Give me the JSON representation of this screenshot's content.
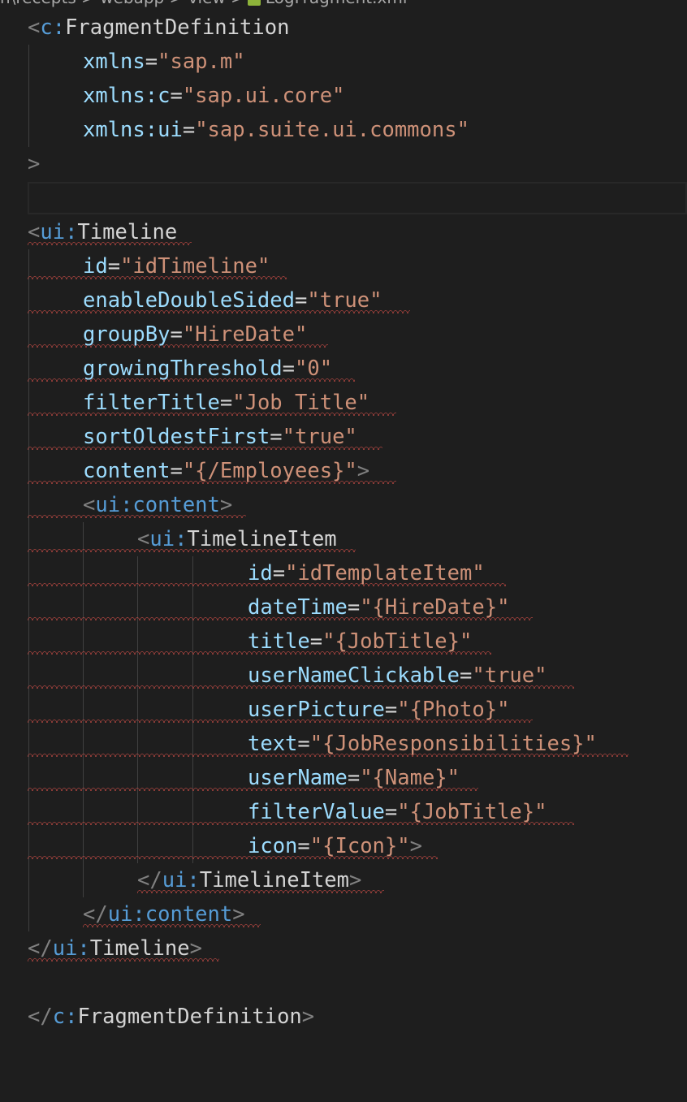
{
  "breadcrumb": {
    "text": "n\\recepts > webapp > view >",
    "file": "LogFragment.xml"
  },
  "colors": {
    "background": "#1e1e1e",
    "tag_bracket": "#808080",
    "namespace": "#569cd6",
    "tag_name": "#d4d4d4",
    "attribute_name": "#9cdcfe",
    "attribute_value": "#ce9178",
    "error_squiggle": "#e0524b"
  },
  "code": {
    "l1": {
      "open": "<",
      "ns": "c:",
      "tag": "FragmentDefinition"
    },
    "l2": {
      "attr": "xmlns",
      "eq": "=",
      "val": "\"sap.m\""
    },
    "l3": {
      "attr": "xmlns:c",
      "eq": "=",
      "val": "\"sap.ui.core\""
    },
    "l4": {
      "attr": "xmlns:ui",
      "eq": "=",
      "val": "\"sap.suite.ui.commons\""
    },
    "l5": {
      "close": ">"
    },
    "l7": {
      "open": "<",
      "ns": "ui:",
      "tag": "Timeline"
    },
    "l8": {
      "attr": "id",
      "eq": "=",
      "val": "\"idTimeline\""
    },
    "l9": {
      "attr": "enableDoubleSided",
      "eq": "=",
      "val": "\"true\""
    },
    "l10": {
      "attr": "groupBy",
      "eq": "=",
      "val": "\"HireDate\""
    },
    "l11": {
      "attr": "growingThreshold",
      "eq": "=",
      "val": "\"0\""
    },
    "l12": {
      "attr": "filterTitle",
      "eq": "=",
      "val": "\"Job Title\""
    },
    "l13": {
      "attr": "sortOldestFirst",
      "eq": "=",
      "val": "\"true\""
    },
    "l14": {
      "attr": "content",
      "eq": "=",
      "val": "\"{/Employees}\"",
      "close": ">"
    },
    "l15": {
      "open": "<",
      "ns": "ui:content",
      "close": ">"
    },
    "l16": {
      "open": "<",
      "ns": "ui:",
      "tag": "TimelineItem"
    },
    "l17": {
      "attr": "id",
      "eq": "=",
      "val": "\"idTemplateItem\""
    },
    "l18": {
      "attr": "dateTime",
      "eq": "=",
      "val": "\"{HireDate}\""
    },
    "l19": {
      "attr": "title",
      "eq": "=",
      "val": "\"{JobTitle}\""
    },
    "l20": {
      "attr": "userNameClickable",
      "eq": "=",
      "val": "\"true\""
    },
    "l21": {
      "attr": "userPicture",
      "eq": "=",
      "val": "\"{Photo}\""
    },
    "l22": {
      "attr": "text",
      "eq": "=",
      "val": "\"{JobResponsibilities}\""
    },
    "l23": {
      "attr": "userName",
      "eq": "=",
      "val": "\"{Name}\""
    },
    "l24": {
      "attr": "filterValue",
      "eq": "=",
      "val": "\"{JobTitle}\""
    },
    "l25": {
      "attr": "icon",
      "eq": "=",
      "val": "\"{Icon}\"",
      "close": ">"
    },
    "l26": {
      "open": "</",
      "ns": "ui:",
      "tag": "TimelineItem",
      "close": ">"
    },
    "l27": {
      "open": "</",
      "ns": "ui:content",
      "close": ">"
    },
    "l28": {
      "open": "</",
      "ns": "ui:",
      "tag": "Timeline",
      "close": ">"
    },
    "l30": {
      "open": "</",
      "ns": "c:",
      "tag": "FragmentDefinition",
      "close": ">"
    }
  }
}
